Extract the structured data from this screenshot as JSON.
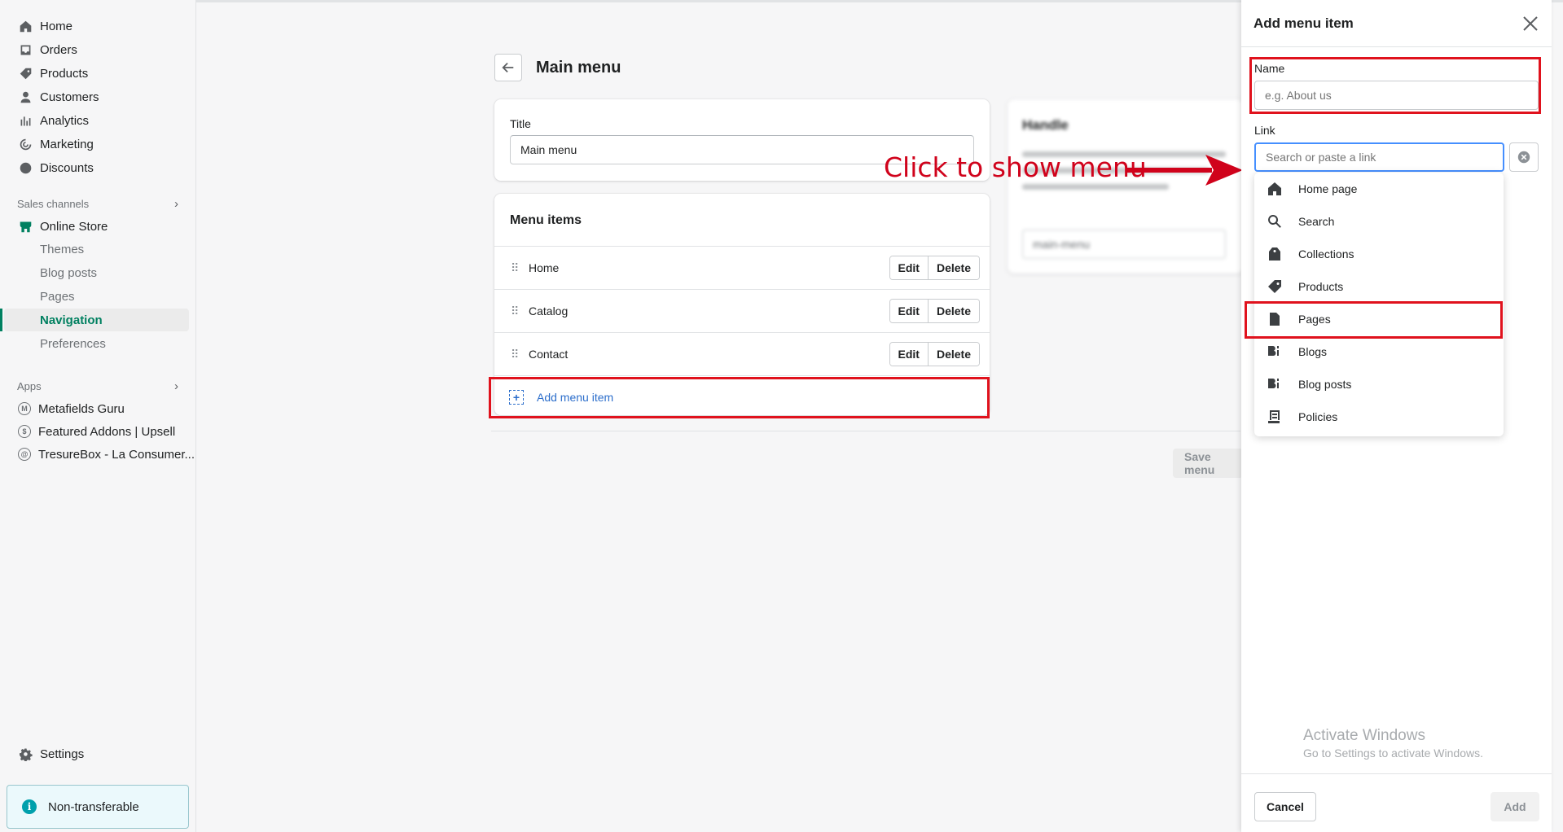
{
  "sidebar": {
    "nav": [
      {
        "label": "Home",
        "icon": "home-icon"
      },
      {
        "label": "Orders",
        "icon": "orders-icon"
      },
      {
        "label": "Products",
        "icon": "tag-icon"
      },
      {
        "label": "Customers",
        "icon": "person-icon"
      },
      {
        "label": "Analytics",
        "icon": "bar-chart-icon"
      },
      {
        "label": "Marketing",
        "icon": "target-icon"
      },
      {
        "label": "Discounts",
        "icon": "discount-icon"
      }
    ],
    "sales_channels_label": "Sales channels",
    "online_store_label": "Online Store",
    "online_store_sub": [
      "Themes",
      "Blog posts",
      "Pages",
      "Navigation",
      "Preferences"
    ],
    "apps_label": "Apps",
    "apps": [
      "Metafields Guru",
      "Featured Addons | Upsell",
      "TresureBox - La Consumer..."
    ],
    "settings_label": "Settings",
    "banner_text": "Non-transferable",
    "banner_icon": "i"
  },
  "main": {
    "page_title": "Main menu",
    "title_label": "Title",
    "title_value": "Main menu",
    "menu_items_heading": "Menu items",
    "items": [
      {
        "label": "Home"
      },
      {
        "label": "Catalog"
      },
      {
        "label": "Contact"
      }
    ],
    "edit_label": "Edit",
    "delete_label": "Delete",
    "add_menu_item_label": "Add menu item",
    "handle_label": "Handle",
    "handle_value": "main-menu",
    "save_menu_label": "Save menu"
  },
  "drawer": {
    "title": "Add menu item",
    "name_label": "Name",
    "name_placeholder": "e.g. About us",
    "link_label": "Link",
    "link_placeholder": "Search or paste a link",
    "options": [
      {
        "label": "Home page",
        "icon": "home-icon"
      },
      {
        "label": "Search",
        "icon": "search-icon"
      },
      {
        "label": "Collections",
        "icon": "collections-icon"
      },
      {
        "label": "Products",
        "icon": "tag-icon"
      },
      {
        "label": "Pages",
        "icon": "page-icon"
      },
      {
        "label": "Blogs",
        "icon": "blog-icon"
      },
      {
        "label": "Blog posts",
        "icon": "blog-icon"
      },
      {
        "label": "Policies",
        "icon": "policy-icon"
      }
    ],
    "cancel_label": "Cancel",
    "add_label": "Add"
  },
  "annotation": "Click to show menu",
  "watermark": {
    "line1": "Activate Windows",
    "line2": "Go to Settings to activate Windows."
  },
  "colors": {
    "accent": "#008060",
    "annotation_red": "#e0121d",
    "link_blue": "#2c6ecb"
  }
}
